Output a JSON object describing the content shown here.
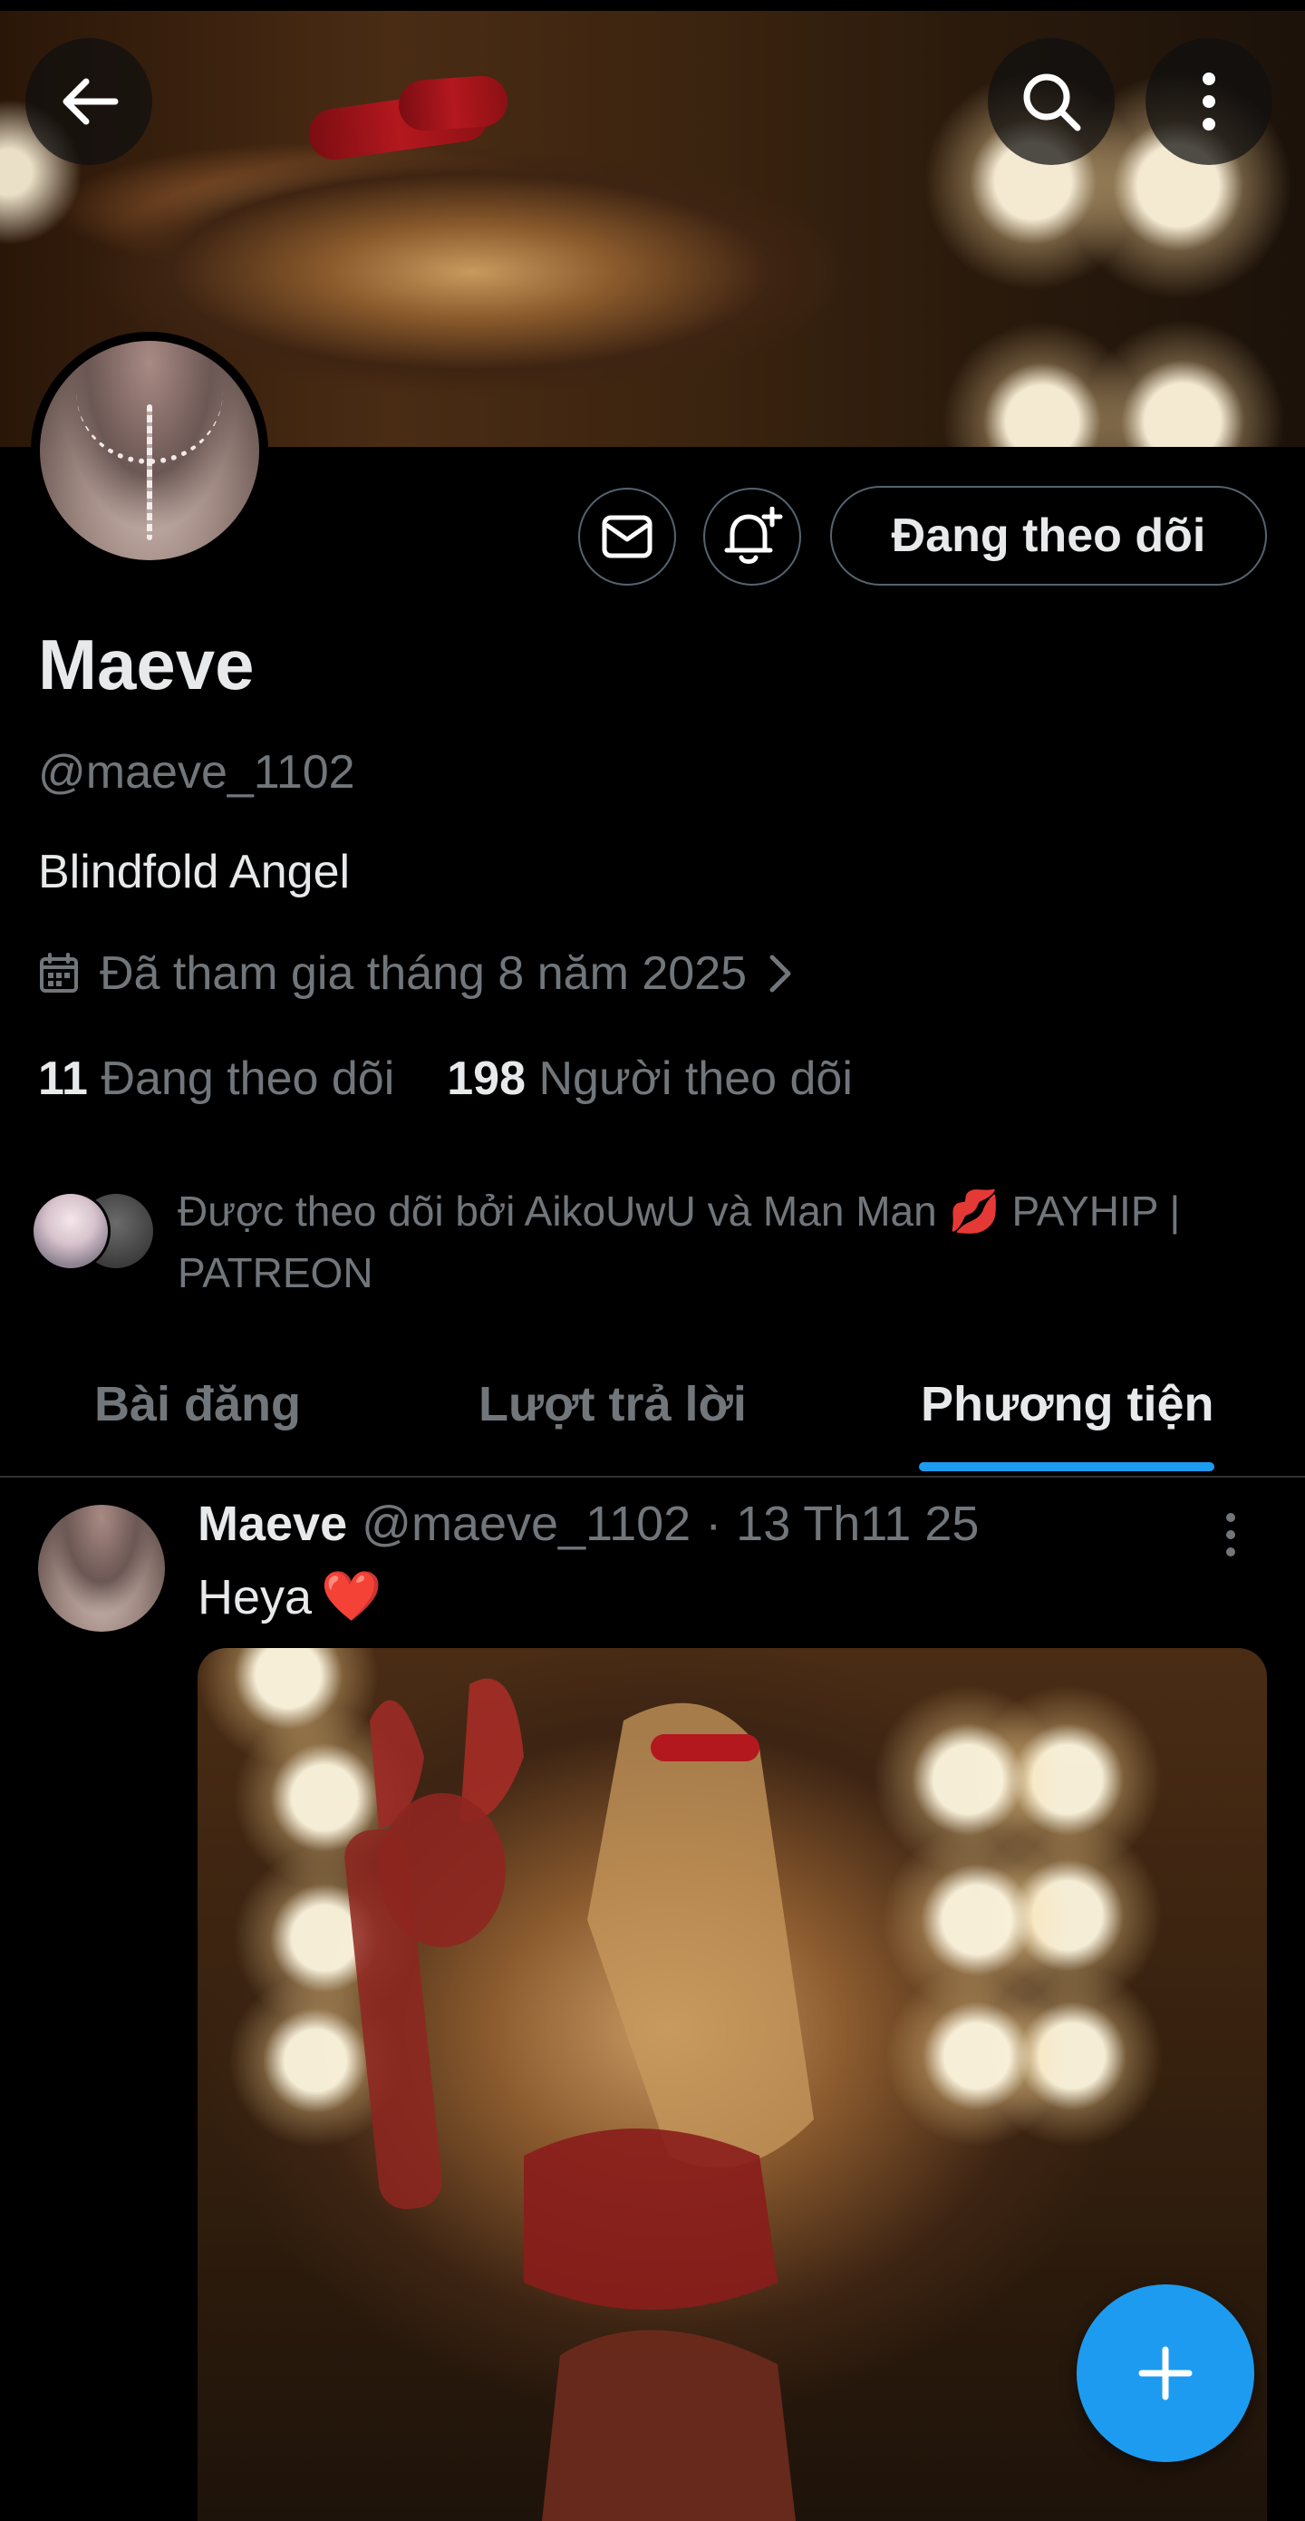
{
  "profile": {
    "name": "Maeve",
    "handle": "@maeve_1102",
    "bio": "Blindfold Angel",
    "joined": "Đã tham gia tháng 8 năm 2025",
    "following_count": "11",
    "following_label": "Đang theo dõi",
    "followers_count": "198",
    "followers_label": "Người theo dõi",
    "followed_by": "Được theo dõi bởi AikoUwU và Man Man 💋 PAYHIP | PATREON"
  },
  "actions": {
    "follow_state_label": "Đang theo dõi"
  },
  "icons": {
    "back": "back-arrow-icon",
    "search": "search-icon",
    "more": "more-vertical-icon",
    "message": "mail-icon",
    "notify": "bell-plus-icon",
    "calendar": "calendar-icon",
    "chevron": "chevron-right-icon",
    "compose": "plus-icon"
  },
  "tabs": [
    {
      "label": "Bài đăng",
      "active": false
    },
    {
      "label": "Lượt trả lời",
      "active": false
    },
    {
      "label": "Phương tiện",
      "active": true
    }
  ],
  "post": {
    "author_name": "Maeve",
    "author_handle": "@maeve_1102",
    "separator": "·",
    "date": "13 Th11 25",
    "text": "Heya",
    "emoji": "❤️"
  },
  "colors": {
    "accent": "#1d9bf0",
    "background": "#000000",
    "primary_text": "#e7e9ea",
    "secondary_text": "#71767b"
  }
}
